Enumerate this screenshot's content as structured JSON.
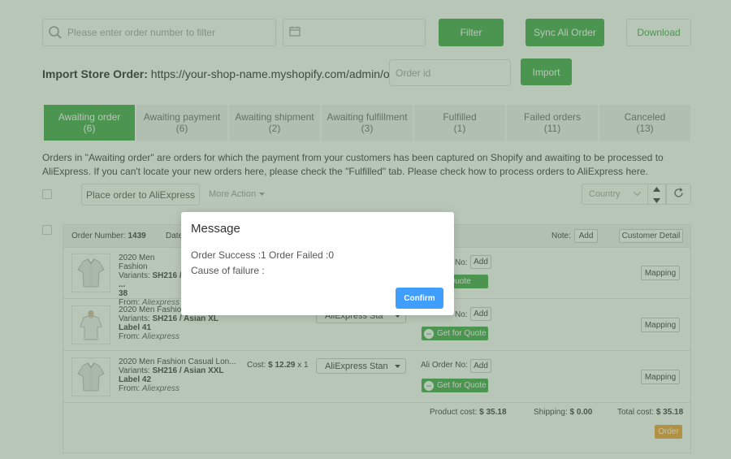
{
  "toolbar": {
    "search_placeholder": "Please enter order number to filter",
    "filter_label": "Filter",
    "sync_label": "Sync Ali Order",
    "download_label": "Download"
  },
  "import": {
    "label": "Import Store Order:",
    "url": "https://your-shop-name.myshopify.com/admin/orders/",
    "placeholder": "Order id",
    "button_label": "Import"
  },
  "tabs": [
    {
      "label": "Awaiting order",
      "count": "(6)",
      "active": true
    },
    {
      "label": "Awaiting payment",
      "count": "(6)"
    },
    {
      "label": "Awaiting shipment",
      "count": "(2)"
    },
    {
      "label": "Awaiting fulfillment",
      "count": "(3)"
    },
    {
      "label": "Fulfilled",
      "count": "(1)"
    },
    {
      "label": "Failed orders",
      "count": "(11)"
    },
    {
      "label": "Canceled",
      "count": "(13)"
    }
  ],
  "info_text": "Orders in \"Awaiting order\" are orders for which the payment from your customers has been captured on Shopify and awaiting to be processed to AliExpress. If you can't locate your new orders here, please check the \"Fulfilled\" tab. Please check how to process orders to AliExpress here.",
  "actions": {
    "place_order_label": "Place order to AliExpress",
    "more_action_label": "More Action",
    "country_placeholder": "Country"
  },
  "order": {
    "number_label": "Order Number:",
    "number": "1439",
    "date_label": "Date",
    "note_label": "Note:",
    "add_label": "Add",
    "customer_detail_label": "Customer Detail",
    "items": [
      {
        "name": "2020 Men Fashion",
        "variants_label": "Variants:",
        "variants": "SH216 / ...",
        "variants_line2": "38",
        "from_label": "From:",
        "from": "Aliexpress",
        "ali_no_label": "No:",
        "add_label": "Add",
        "quote_label": "for Quote",
        "mapping_label": "Mapping"
      },
      {
        "name": "2020 Men Fashio",
        "variants_label": "Variants:",
        "variants": "SH216 / Asian XL",
        "variants_line2": "Label 41",
        "from_label": "From:",
        "from": "Aliexpress",
        "ship_method": "AliExpress Sta",
        "ali_no_label": "No:",
        "add_label": "Add",
        "quote_label": "Get for Quote",
        "mapping_label": "Mapping"
      },
      {
        "name": "2020 Men Fashion Casual Lon...",
        "variants_label": "Variants:",
        "variants": "SH216 / Asian XXL",
        "variants_line2": "Label 42",
        "from_label": "From:",
        "from": "Aliexpress",
        "cost_label": "Cost:",
        "cost": "$ 12.29",
        "qty": "x 1",
        "ship_method": "AliExpress Stan",
        "ali_no_label": "Ali Order No:",
        "add_label": "Add",
        "quote_label": "Get for Quote",
        "mapping_label": "Mapping"
      }
    ],
    "product_cost_label": "Product cost:",
    "product_cost": "$ 35.18",
    "shipping_label": "Shipping:",
    "shipping": "$ 0.00",
    "total_label": "Total cost:",
    "total": "$ 35.18",
    "order_button_label": "Order"
  },
  "modal": {
    "title": "Message",
    "line1": "Order Success :1 Order Failed :0",
    "line2": "Cause of failure :",
    "confirm_label": "Confirm"
  },
  "colors": {
    "green": "#3aa745",
    "blue": "#409eff",
    "orange": "#f29f2d",
    "overlay": "rgba(98,128,96,0.45)"
  }
}
